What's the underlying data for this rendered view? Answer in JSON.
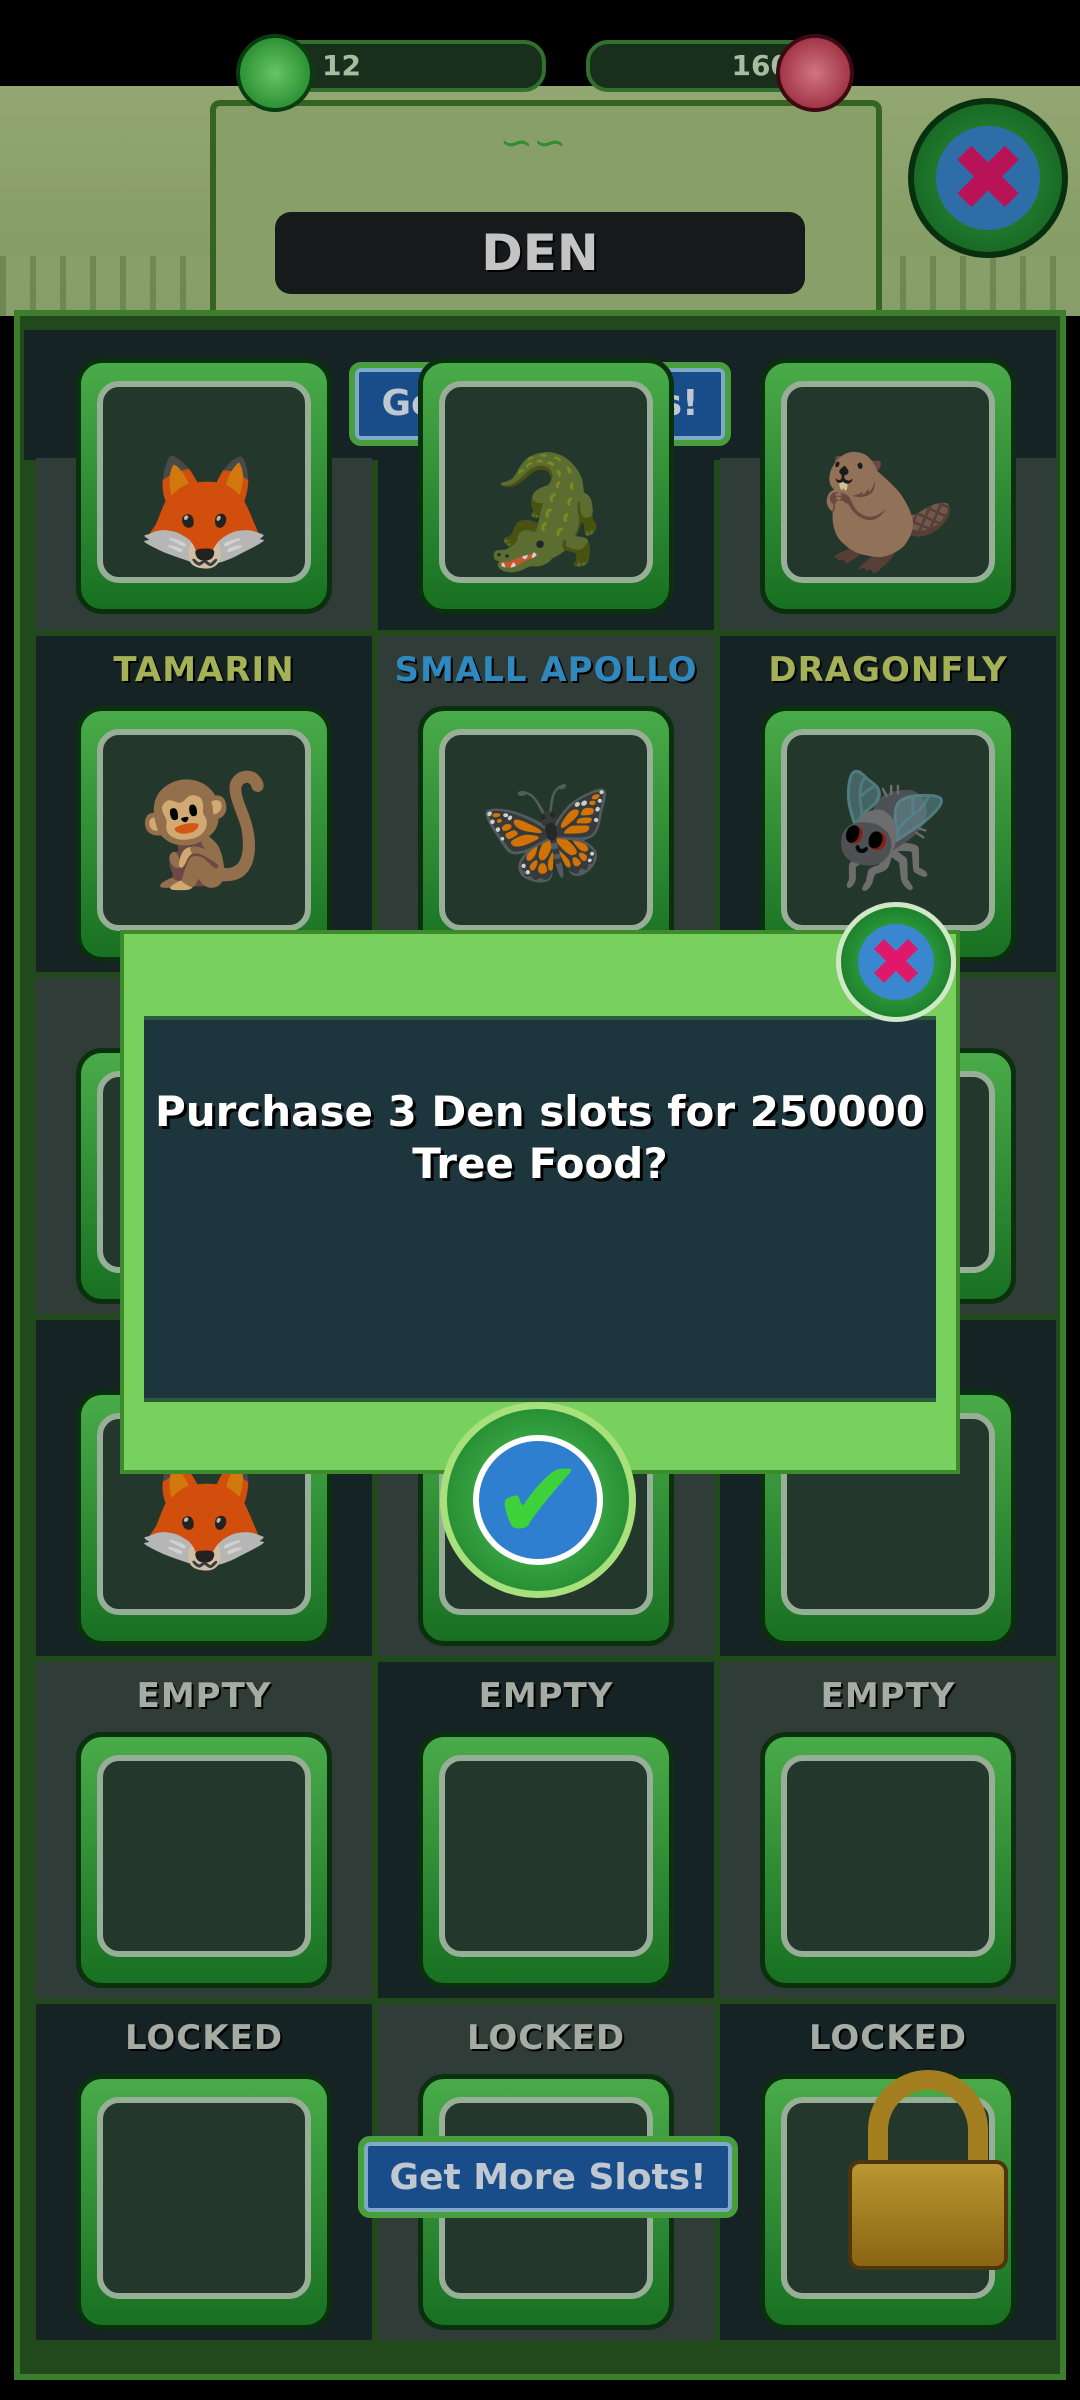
{
  "header": {
    "title": "DEN",
    "left_resource": {
      "value": "12",
      "icon": "green-gem-icon",
      "color": "#2bbf3a"
    },
    "right_resource": {
      "value": "160",
      "icon": "red-crystal-icon",
      "color": "#d13a4c"
    }
  },
  "buttons": {
    "get_more_slots_top": "Get More Slots!",
    "get_more_slots_bottom": "Get More Slots!"
  },
  "grid": {
    "row1": [
      {
        "name": "",
        "label_color": "#c9d86a",
        "icon": "fennec-fox-icon",
        "glyph": "🦊"
      },
      {
        "name": "",
        "label_color": "#c9d86a",
        "icon": "crocodile-icon",
        "glyph": "🐊"
      },
      {
        "name": "",
        "label_color": "#c9d86a",
        "icon": "wombat-icon",
        "glyph": "🦫"
      }
    ],
    "row2": [
      {
        "name": "TAMARIN",
        "label_color": "#c9d86a",
        "icon": "tamarin-icon",
        "glyph": "🐒"
      },
      {
        "name": "SMALL APOLLO",
        "label_color": "#3aa7e8",
        "icon": "butterfly-icon",
        "glyph": "🦋"
      },
      {
        "name": "DRAGONFLY",
        "label_color": "#c9d86a",
        "icon": "dragonfly-icon",
        "glyph": "🪰"
      }
    ],
    "row3": [
      {
        "name": "",
        "label_color": "#c9d86a",
        "icon": "",
        "glyph": ""
      },
      {
        "name": "",
        "label_color": "#c9d86a",
        "icon": "",
        "glyph": ""
      },
      {
        "name": "",
        "label_color": "#c9d86a",
        "icon": "",
        "glyph": ""
      }
    ],
    "row4": [
      {
        "name": "",
        "label_color": "#c9d86a",
        "icon": "fennec-fox-icon",
        "glyph": "🦊"
      },
      {
        "name": "",
        "label_color": "#c9d86a",
        "icon": "",
        "glyph": ""
      },
      {
        "name": "",
        "label_color": "#c9d86a",
        "icon": "",
        "glyph": ""
      }
    ],
    "row5": [
      {
        "name": "EMPTY",
        "label_color": "#c8d2c8"
      },
      {
        "name": "EMPTY",
        "label_color": "#c8d2c8"
      },
      {
        "name": "EMPTY",
        "label_color": "#c8d2c8"
      }
    ],
    "row6": [
      {
        "name": "LOCKED",
        "label_color": "#c8d2c8"
      },
      {
        "name": "LOCKED",
        "label_color": "#c8d2c8"
      },
      {
        "name": "LOCKED",
        "label_color": "#c8d2c8"
      }
    ]
  },
  "dialog": {
    "message_line1": "Purchase 3 Den slots for 250000",
    "message_line2": "Tree Food?",
    "close_icon": "close-x-icon",
    "confirm_icon": "checkmark-icon"
  }
}
